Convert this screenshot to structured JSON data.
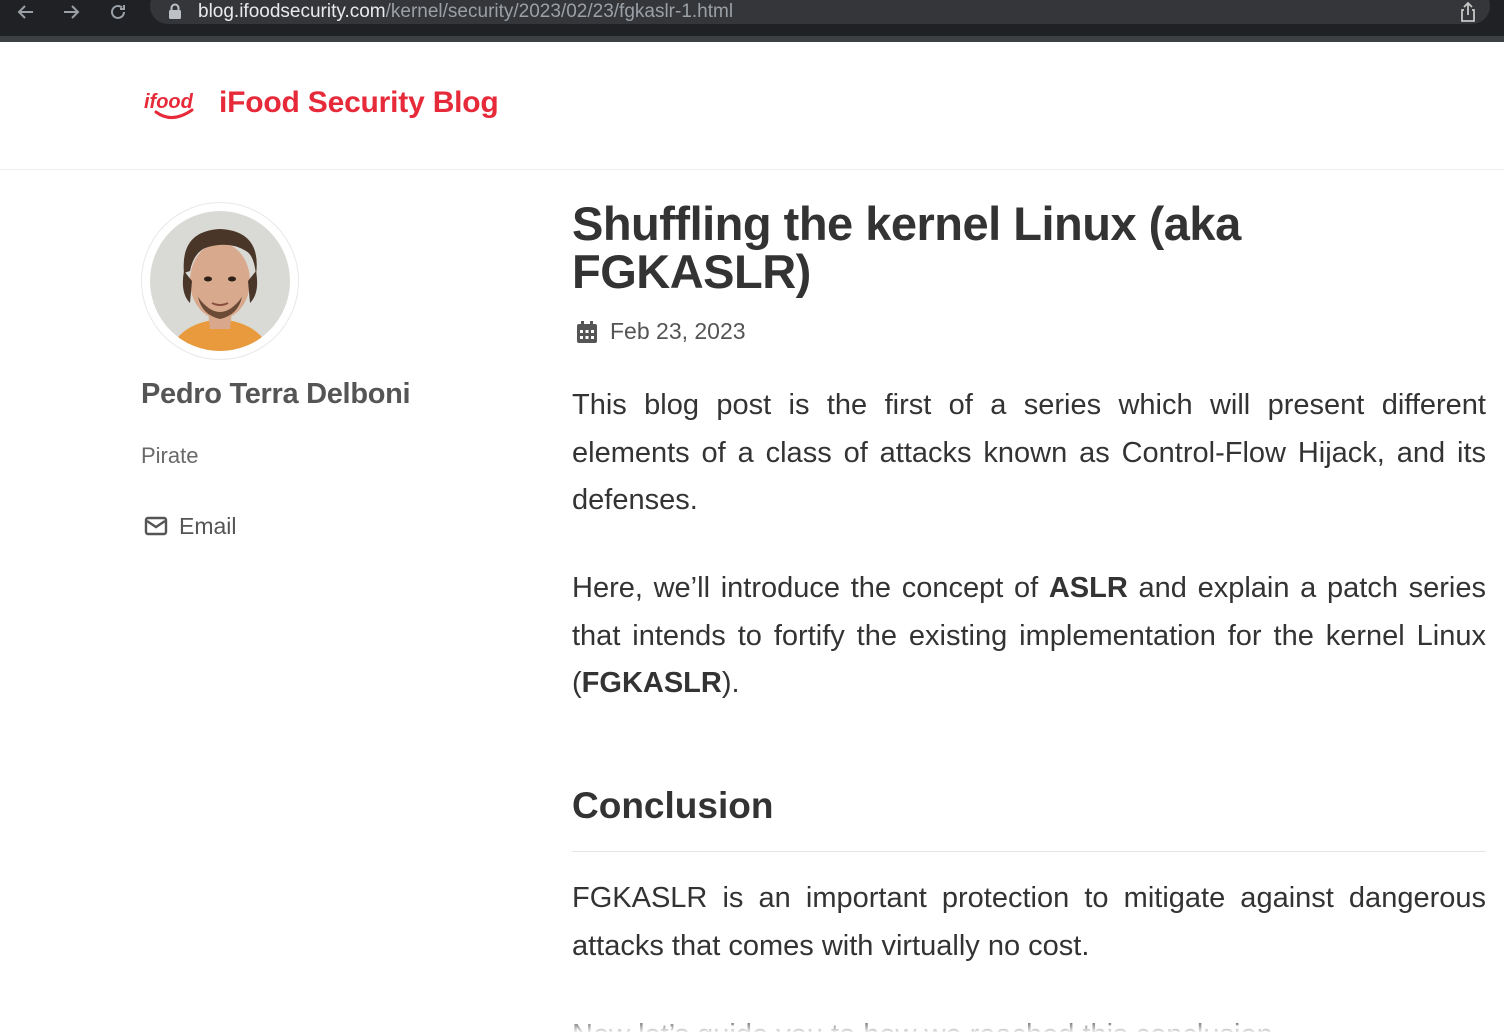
{
  "browser": {
    "url_domain": "blog.ifoodsecurity.com",
    "url_path": "/kernel/security/2023/02/23/fgkaslr-1.html"
  },
  "site": {
    "logo_text": "ifood",
    "title": "iFood Security Blog",
    "brand_color": "#e62a3a"
  },
  "author": {
    "name": "Pedro Terra Delboni",
    "bio": "Pirate",
    "email_label": "Email"
  },
  "post": {
    "title": "Shuffling the kernel Linux (aka FGKASLR)",
    "date": "Feb 23, 2023",
    "intro": "This blog post is the first of a series which will present different elements of a class of attacks known as Control-Flow Hijack, and its defenses.",
    "p2_before": "Here, we’ll introduce the concept of ",
    "p2_bold1": "ASLR",
    "p2_middle": " and explain a patch series that intends to fortify the existing implementation for the kernel Linux (",
    "p2_bold2": "FGKASLR",
    "p2_after": ").",
    "section_heading": "Conclusion",
    "conclusion": "FGKASLR is an important protection to mitigate against dangerous attacks that comes with virtually no cost.",
    "next_line": "Now let’s guide you to how we reached this conclusion."
  }
}
